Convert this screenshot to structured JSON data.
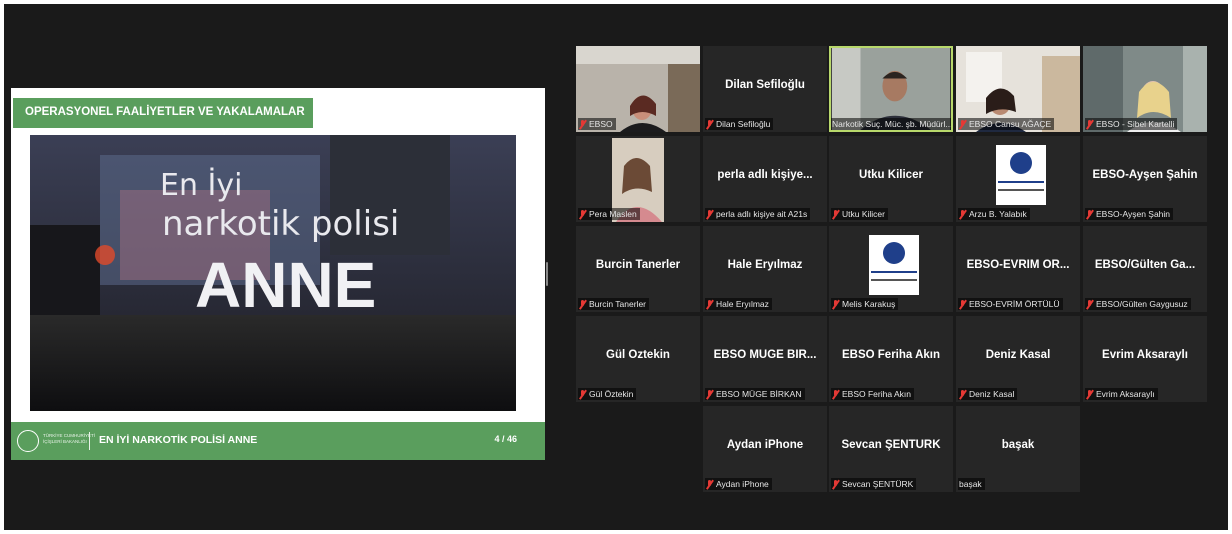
{
  "shared_screen": {
    "header_title": "OPERASYONEL FAALİYETLER VE YAKALAMALAR",
    "footer_ministry_line1": "TÜRKİYE CUMHURİYETİ",
    "footer_ministry_line2": "İÇİŞLERİ BAKANLIĞI",
    "footer_title": "EN İYİ NARKOTİK POLİSİ ANNE",
    "page_indicator": "4 / 46",
    "video_text_line1": "En İyi",
    "video_text_line2": "narkotik polisi",
    "video_text_line3": "ANNE"
  },
  "colors": {
    "slide_green": "#5a9e5d",
    "active_speaker_border": "#b8d86b",
    "muted_mic": "#e53935",
    "tile_bg": "#262626",
    "window_bg": "#1a1a1a"
  },
  "participants": [
    {
      "label": "EBSO",
      "muted": true,
      "video": true
    },
    {
      "display_name": "Dilan Sefiloğlu",
      "label": "Dilan Sefiloğlu",
      "muted": true
    },
    {
      "label": "Narkotik Suç. Müc. şb. Müdürl...",
      "muted": false,
      "video": true,
      "active_speaker": true
    },
    {
      "label": "EBSO Cansu AĞAÇE",
      "muted": true,
      "video": true
    },
    {
      "label": "EBSO - Sibel Kartelli",
      "muted": true,
      "video": true
    },
    {
      "label": "Pera Maslen",
      "muted": true,
      "video": true
    },
    {
      "display_name": "perla adlı kişiye...",
      "label": "perla adlı kişiye ait A21s",
      "muted": true
    },
    {
      "display_name": "Utku Kilicer",
      "label": "Utku Kilicer",
      "muted": true
    },
    {
      "label": "Arzu B. Yalabık",
      "muted": true,
      "logo": true
    },
    {
      "display_name": "EBSO-Ayşen Şahin",
      "label": "EBSO-Ayşen Şahin",
      "muted": true
    },
    {
      "display_name": "Burcin Tanerler",
      "label": "Burcin Tanerler",
      "muted": true
    },
    {
      "display_name": "Hale Eryılmaz",
      "label": "Hale Eryılmaz",
      "muted": true
    },
    {
      "label": "Melis Karakuş",
      "muted": true,
      "logo": true
    },
    {
      "display_name": "EBSO-EVRİM ÖR...",
      "label": "EBSO-EVRİM ÖRTÜLÜ",
      "muted": true
    },
    {
      "display_name": "EBSO/Gülten Ga...",
      "label": "EBSO/Gülten Gaygusuz",
      "muted": true
    },
    {
      "display_name": "Gül Öztekin",
      "label": "Gül Öztekin",
      "muted": true
    },
    {
      "display_name": "EBSO MÜGE BİR...",
      "label": "EBSO MÜGE BİRKAN",
      "muted": true
    },
    {
      "display_name": "EBSO Feriha Akın",
      "label": "EBSO Feriha Akın",
      "muted": true
    },
    {
      "display_name": "Deniz Kasal",
      "label": "Deniz Kasal",
      "muted": true
    },
    {
      "display_name": "Evrim Aksaraylı",
      "label": "Evrim Aksaraylı",
      "muted": true
    },
    {
      "display_name": "Aydan iPhone",
      "label": "Aydan iPhone",
      "muted": true
    },
    {
      "display_name": "Sevcan ŞENTÜRK",
      "label": "Sevcan ŞENTÜRK",
      "muted": true
    },
    {
      "display_name": "başak",
      "label": "başak",
      "muted": false
    }
  ]
}
